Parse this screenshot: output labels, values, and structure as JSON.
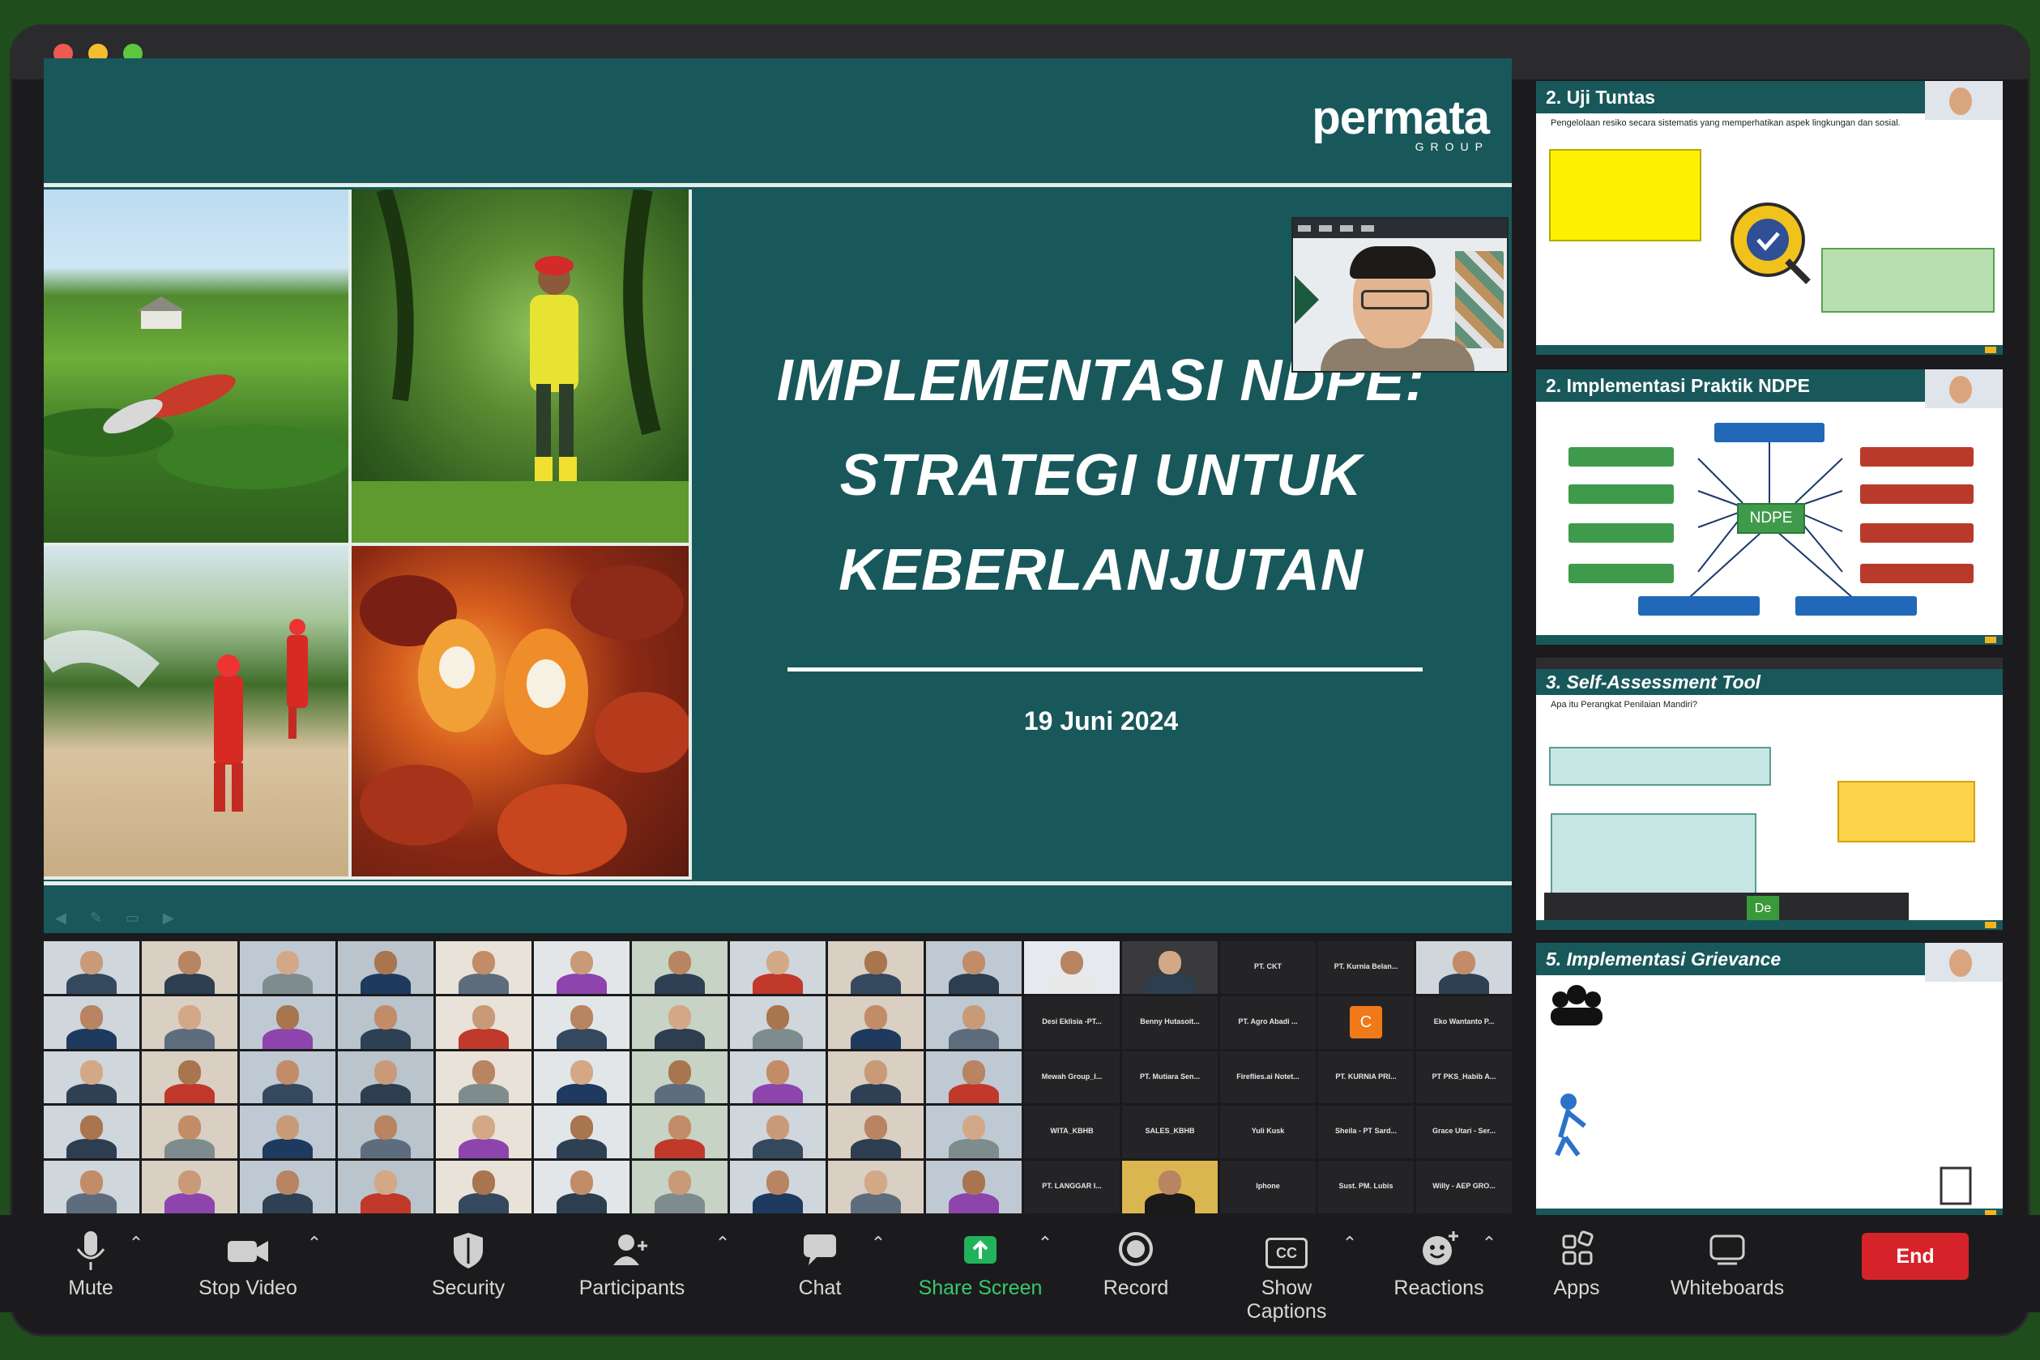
{
  "slide": {
    "logo_name": "permata",
    "logo_sub": "GROUP",
    "title_lines": [
      "IMPLEMENTASI NDPE:",
      "STRATEGI UNTUK",
      "KEBERLANJUTAN"
    ],
    "date": "19 Juni 2024"
  },
  "panels": [
    {
      "title": "2. Uji Tuntas",
      "subtitle": "Pengelolaan resiko secara sistematis yang memperhatikan aspek lingkungan dan sosial."
    },
    {
      "title": "2. Implementasi Praktik NDPE",
      "center_node": "NDPE"
    },
    {
      "title": "3. Self-Assessment Tool",
      "subtitle": "Apa itu Perangkat Penilaian Mandiri?",
      "mini_label": "De"
    },
    {
      "title": "5. Implementasi Grievance"
    }
  ],
  "gallery": {
    "names": [
      "PT. CKT",
      "PT. Kurnia Belan...",
      "Desi Eklisia -PT...",
      "Benny Hutasoit...",
      "PT. Agro Abadi ...",
      "Eko Wantanto P...",
      "Mewah Group_I...",
      "PT. Mutiara Sen...",
      "Fireflies.ai Notet...",
      "PT. KURNIA PRI...",
      "PT PKS_Habib A...",
      "WITA_KBHB",
      "SALES_KBHB",
      "Yuli Kusk",
      "Sheila - PT Sard...",
      "Grace Utari - Ser...",
      "PT. LANGGAR I...",
      "Iphone",
      "Sust. PM. Lubis",
      "Willy - AEP GRO..."
    ],
    "avatar_letter": "C"
  },
  "toolbar": {
    "mute": "Mute",
    "stop_video": "Stop Video",
    "security": "Security",
    "participants": "Participants",
    "chat": "Chat",
    "share_screen": "Share Screen",
    "record": "Record",
    "show_captions": "Show Captions",
    "cc": "CC",
    "reactions": "Reactions",
    "apps": "Apps",
    "whiteboards": "Whiteboards",
    "end": "End"
  },
  "colors": {
    "slide_teal": "#19585a",
    "share_green": "#39c86d",
    "end_red": "#d6232a"
  }
}
